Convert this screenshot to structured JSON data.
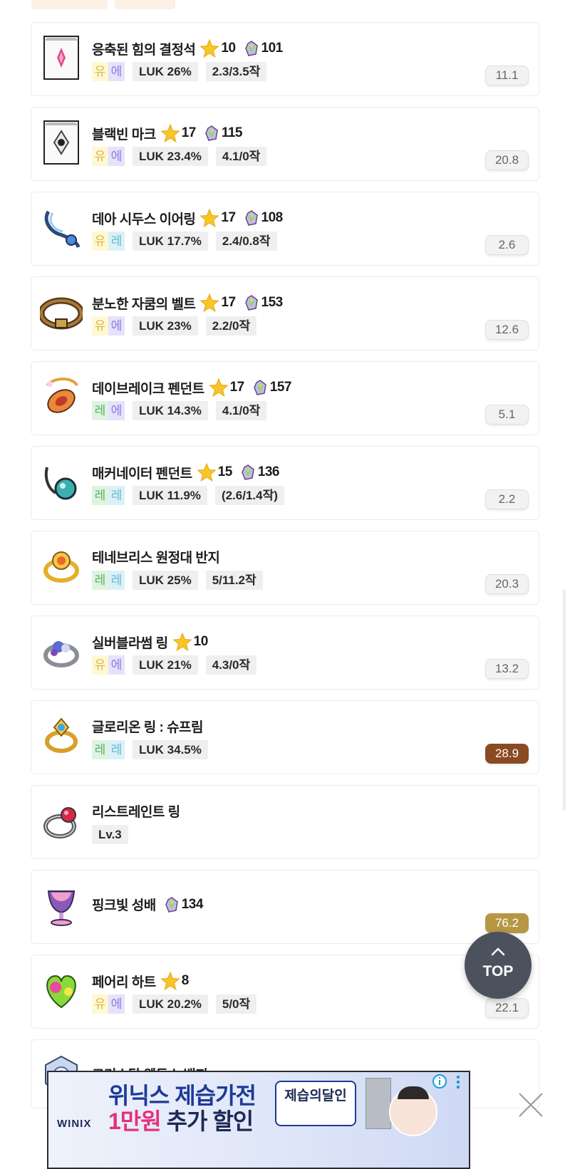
{
  "colors": {
    "score_default_bg": "#f2f2f2",
    "score_brown": "#8a4a22",
    "score_gold": "#b69745",
    "star": "#f7c528",
    "top_button": "#4b525d"
  },
  "items": [
    {
      "name": "응축된 힘의 결정석",
      "icon": "crystal-icon",
      "stars": "10",
      "flame": "101",
      "grade": [
        "유",
        "에"
      ],
      "chips": [
        "LUK 26%",
        "2.3/3.5작"
      ],
      "score": "11.1"
    },
    {
      "name": "블랙빈 마크",
      "icon": "mark-icon",
      "stars": "17",
      "flame": "115",
      "grade": [
        "유",
        "에"
      ],
      "chips": [
        "LUK 23.4%",
        "4.1/0작"
      ],
      "score": "20.8"
    },
    {
      "name": "데아 시두스 이어링",
      "icon": "earring-icon",
      "stars": "17",
      "flame": "108",
      "grade": [
        "유",
        "레"
      ],
      "chips": [
        "LUK 17.7%",
        "2.4/0.8작"
      ],
      "score": "2.6"
    },
    {
      "name": "분노한 자쿰의 벨트",
      "icon": "belt-icon",
      "stars": "17",
      "flame": "153",
      "grade": [
        "유",
        "에"
      ],
      "chips": [
        "LUK 23%",
        "2.2/0작"
      ],
      "score": "12.6"
    },
    {
      "name": "데이브레이크 펜던트",
      "icon": "pendant-icon",
      "stars": "17",
      "flame": "157",
      "grade": [
        "레",
        "에"
      ],
      "chips": [
        "LUK 14.3%",
        "4.1/0작"
      ],
      "score": "5.1"
    },
    {
      "name": "매커네이터 펜던트",
      "icon": "pendant-teal-icon",
      "stars": "15",
      "flame": "136",
      "grade": [
        "레",
        "레"
      ],
      "chips": [
        "LUK 11.9%",
        "(2.6/1.4작)"
      ],
      "score": "2.2"
    },
    {
      "name": "테네브리스 원정대 반지",
      "icon": "ring-gold-icon",
      "stars": null,
      "flame": null,
      "grade": [
        "레",
        "레"
      ],
      "chips": [
        "LUK 25%",
        "5/11.2작"
      ],
      "score": "20.3"
    },
    {
      "name": "실버블라썸 링",
      "icon": "ring-silver-icon",
      "stars": "10",
      "flame": null,
      "grade": [
        "유",
        "에"
      ],
      "chips": [
        "LUK 21%",
        "4.3/0작"
      ],
      "score": "13.2"
    },
    {
      "name": "글로리온 링 : 슈프림",
      "icon": "ring-glorion-icon",
      "stars": null,
      "flame": null,
      "grade": [
        "레",
        "레"
      ],
      "chips": [
        "LUK 34.5%"
      ],
      "score": "28.9",
      "score_style": "brown"
    },
    {
      "name": "리스트레인트 링",
      "icon": "ring-restraint-icon",
      "stars": null,
      "flame": null,
      "grade": null,
      "chips": [
        "Lv.3"
      ],
      "score": null
    },
    {
      "name": "핑크빛 성배",
      "icon": "chalice-icon",
      "stars": null,
      "flame": "134",
      "grade": null,
      "chips": [],
      "score": "76.2",
      "score_style": "gold"
    },
    {
      "name": "페어리 하트",
      "icon": "heart-icon",
      "stars": "8",
      "flame": null,
      "grade": [
        "유",
        "에"
      ],
      "chips": [
        "LUK 20.2%",
        "5/0작"
      ],
      "score": "22.1"
    },
    {
      "name": "크리스탈 웬투스 뱃지",
      "icon": "badge-icon",
      "stars": null,
      "flame": null,
      "grade": null,
      "chips": [],
      "score": null
    }
  ],
  "top_button": {
    "label": "TOP"
  },
  "ad": {
    "brand": "WINIX",
    "headline1": "위닉스 제습가전",
    "headline2_pink": "1만원",
    "headline2_rest": " 추가 할인",
    "button": "제습의달인"
  }
}
